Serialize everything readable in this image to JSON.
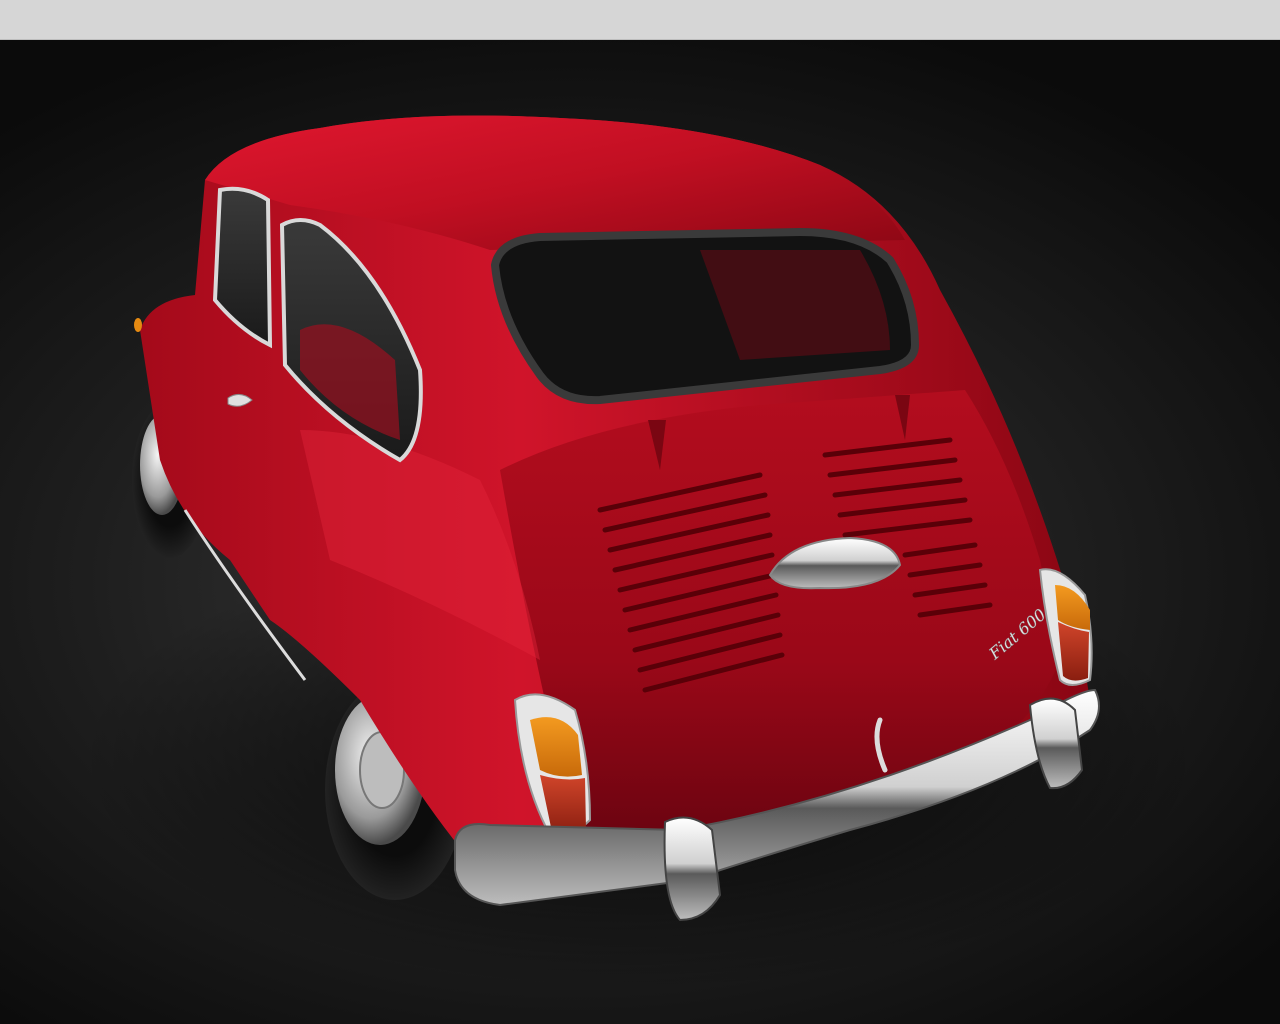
{
  "window": {
    "background": "#1a1a1a",
    "top_bar_color": "#d6d6d6"
  },
  "scene": {
    "subject": "red-classic-car-rear-view",
    "colors": {
      "body": "#c20f22",
      "body_shadow": "#5a0008",
      "chrome": "#e8e8e8",
      "indicator": "#e58a12",
      "tail_light": "#b3321e"
    },
    "badge_text": "Fiat 600"
  }
}
